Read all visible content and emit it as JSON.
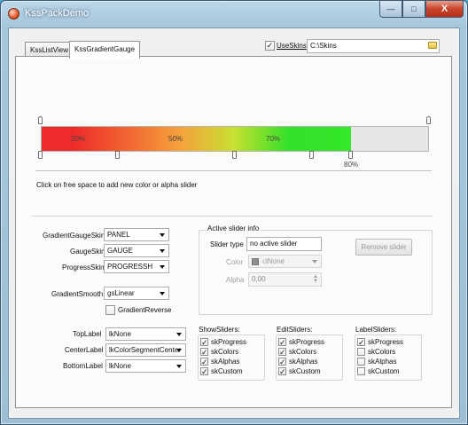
{
  "window": {
    "title": "KssPackDemo",
    "caption": {
      "minimize": "—",
      "maximize": "□",
      "close": "X"
    }
  },
  "tabs": [
    {
      "label": "KssListView",
      "active": false
    },
    {
      "label": "KssGradientGauge",
      "active": true
    }
  ],
  "skins": {
    "use_skins_label": "UseSkins",
    "use_skins_checked": true,
    "path": "C:\\Skins"
  },
  "gauge": {
    "progress_percent": 80,
    "labels": [
      "20%",
      "50%",
      "70%"
    ],
    "progress_label": "80%",
    "hint": "Click on free space to add new color or alpha slider"
  },
  "settings": {
    "gradient_gauge_skin": {
      "label": "GradientGaugeSkin",
      "value": "PANEL"
    },
    "gauge_skin": {
      "label": "GaugeSkin",
      "value": "GAUGE"
    },
    "progress_skin": {
      "label": "ProgressSkin",
      "value": "PROGRESSH"
    },
    "gradient_smooth": {
      "label": "GradientSmooth",
      "value": "gsLinear"
    },
    "gradient_reverse": {
      "label": "GradientReverse",
      "checked": false
    },
    "top_label": {
      "label": "TopLabel",
      "value": "lkNone"
    },
    "center_label": {
      "label": "CenterLabel",
      "value": "lkColorSegmentCenter"
    },
    "bottom_label": {
      "label": "BottomLabel",
      "value": "lkNone"
    }
  },
  "active_slider": {
    "title": "Active slider info",
    "slider_type_label": "Slider type",
    "slider_type_value": "no active slider",
    "color_label": "Color",
    "color_value": "clNone",
    "alpha_label": "Alpha",
    "alpha_value": "0,00",
    "remove_button": "Remove slider"
  },
  "show_sliders": {
    "title": "ShowSliders:",
    "items": [
      {
        "label": "skProgress",
        "checked": true
      },
      {
        "label": "skColors",
        "checked": true
      },
      {
        "label": "skAlphas",
        "checked": true
      },
      {
        "label": "skCustom",
        "checked": true
      }
    ]
  },
  "edit_sliders": {
    "title": "EditSliders:",
    "items": [
      {
        "label": "skProgress",
        "checked": true
      },
      {
        "label": "skColors",
        "checked": true
      },
      {
        "label": "skAlphas",
        "checked": true
      },
      {
        "label": "skCustom",
        "checked": true
      }
    ]
  },
  "label_sliders": {
    "title": "LabelSliders:",
    "items": [
      {
        "label": "skProgress",
        "checked": true
      },
      {
        "label": "skColors",
        "checked": false
      },
      {
        "label": "skAlphas",
        "checked": false
      },
      {
        "label": "skCustom",
        "checked": false
      }
    ]
  }
}
